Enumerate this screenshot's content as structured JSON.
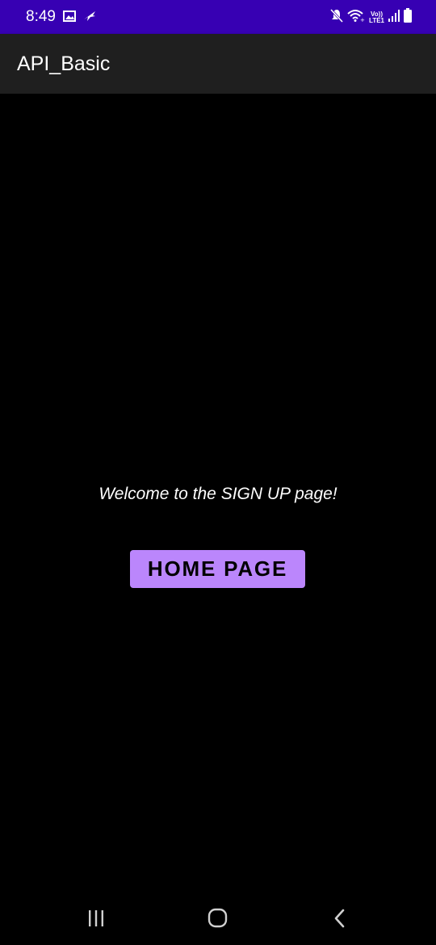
{
  "status_bar": {
    "time": "8:49",
    "background_color": "#3700b3",
    "left_icons": [
      "gallery-icon",
      "flight-icon"
    ],
    "right_icons": [
      "mute-icon",
      "wifi-icon",
      "volte-icon",
      "signal-icon",
      "battery-icon"
    ],
    "volte_line1": "Vo))",
    "volte_line2": "LTE1"
  },
  "app_bar": {
    "title": "API_Basic",
    "background_color": "#1f1f1f"
  },
  "main": {
    "welcome_text": "Welcome to the SIGN UP page!",
    "home_button_label": "HOME PAGE",
    "button_color": "#bb86fc"
  },
  "nav_bar": {
    "icons": [
      "recent-apps-icon",
      "home-icon",
      "back-icon"
    ]
  }
}
